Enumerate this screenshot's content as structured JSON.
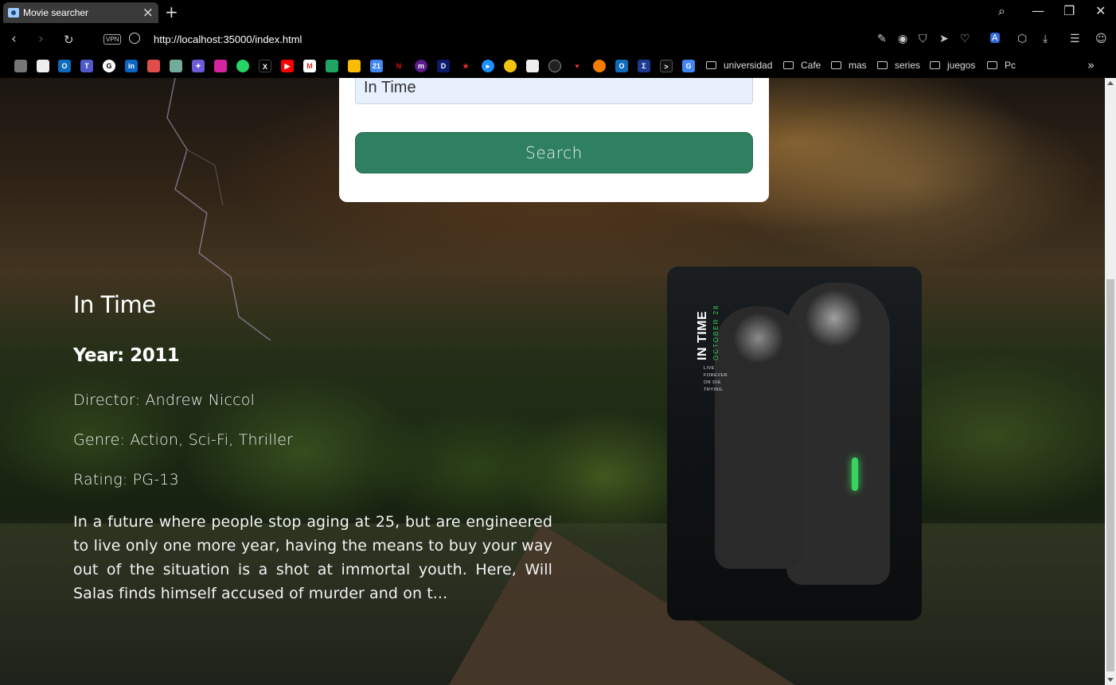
{
  "browser": {
    "tab_title": "Movie searcher",
    "url": "http://localhost:35000/index.html",
    "vpn_label": "VPN",
    "bookmark_folders": [
      "universidad",
      "Cafe",
      "mas",
      "series",
      "juegos",
      "Pc"
    ]
  },
  "search": {
    "query": "In Time",
    "button_label": "Search"
  },
  "movie": {
    "title": "In Time",
    "year": "Year: 2011",
    "director": "Director: Andrew Niccol",
    "genre": "Genre: Action, Sci-Fi, Thriller",
    "rating": "Rating: PG-13",
    "plot": "In a future where people stop aging at 25, but are engineered to live only one more year, having the means to buy your way out of the situation is a shot at immortal youth. Here, Will Salas finds himself accused of murder and on t...",
    "poster": {
      "title": "IN TIME",
      "date": "OCTOBER 28",
      "tagline": "LIVE FOREVER OR DIE TRYING."
    }
  },
  "colors": {
    "search_button": "#2e8060",
    "input_bg": "#e8f0fe",
    "card_bg": "#ffffff"
  }
}
